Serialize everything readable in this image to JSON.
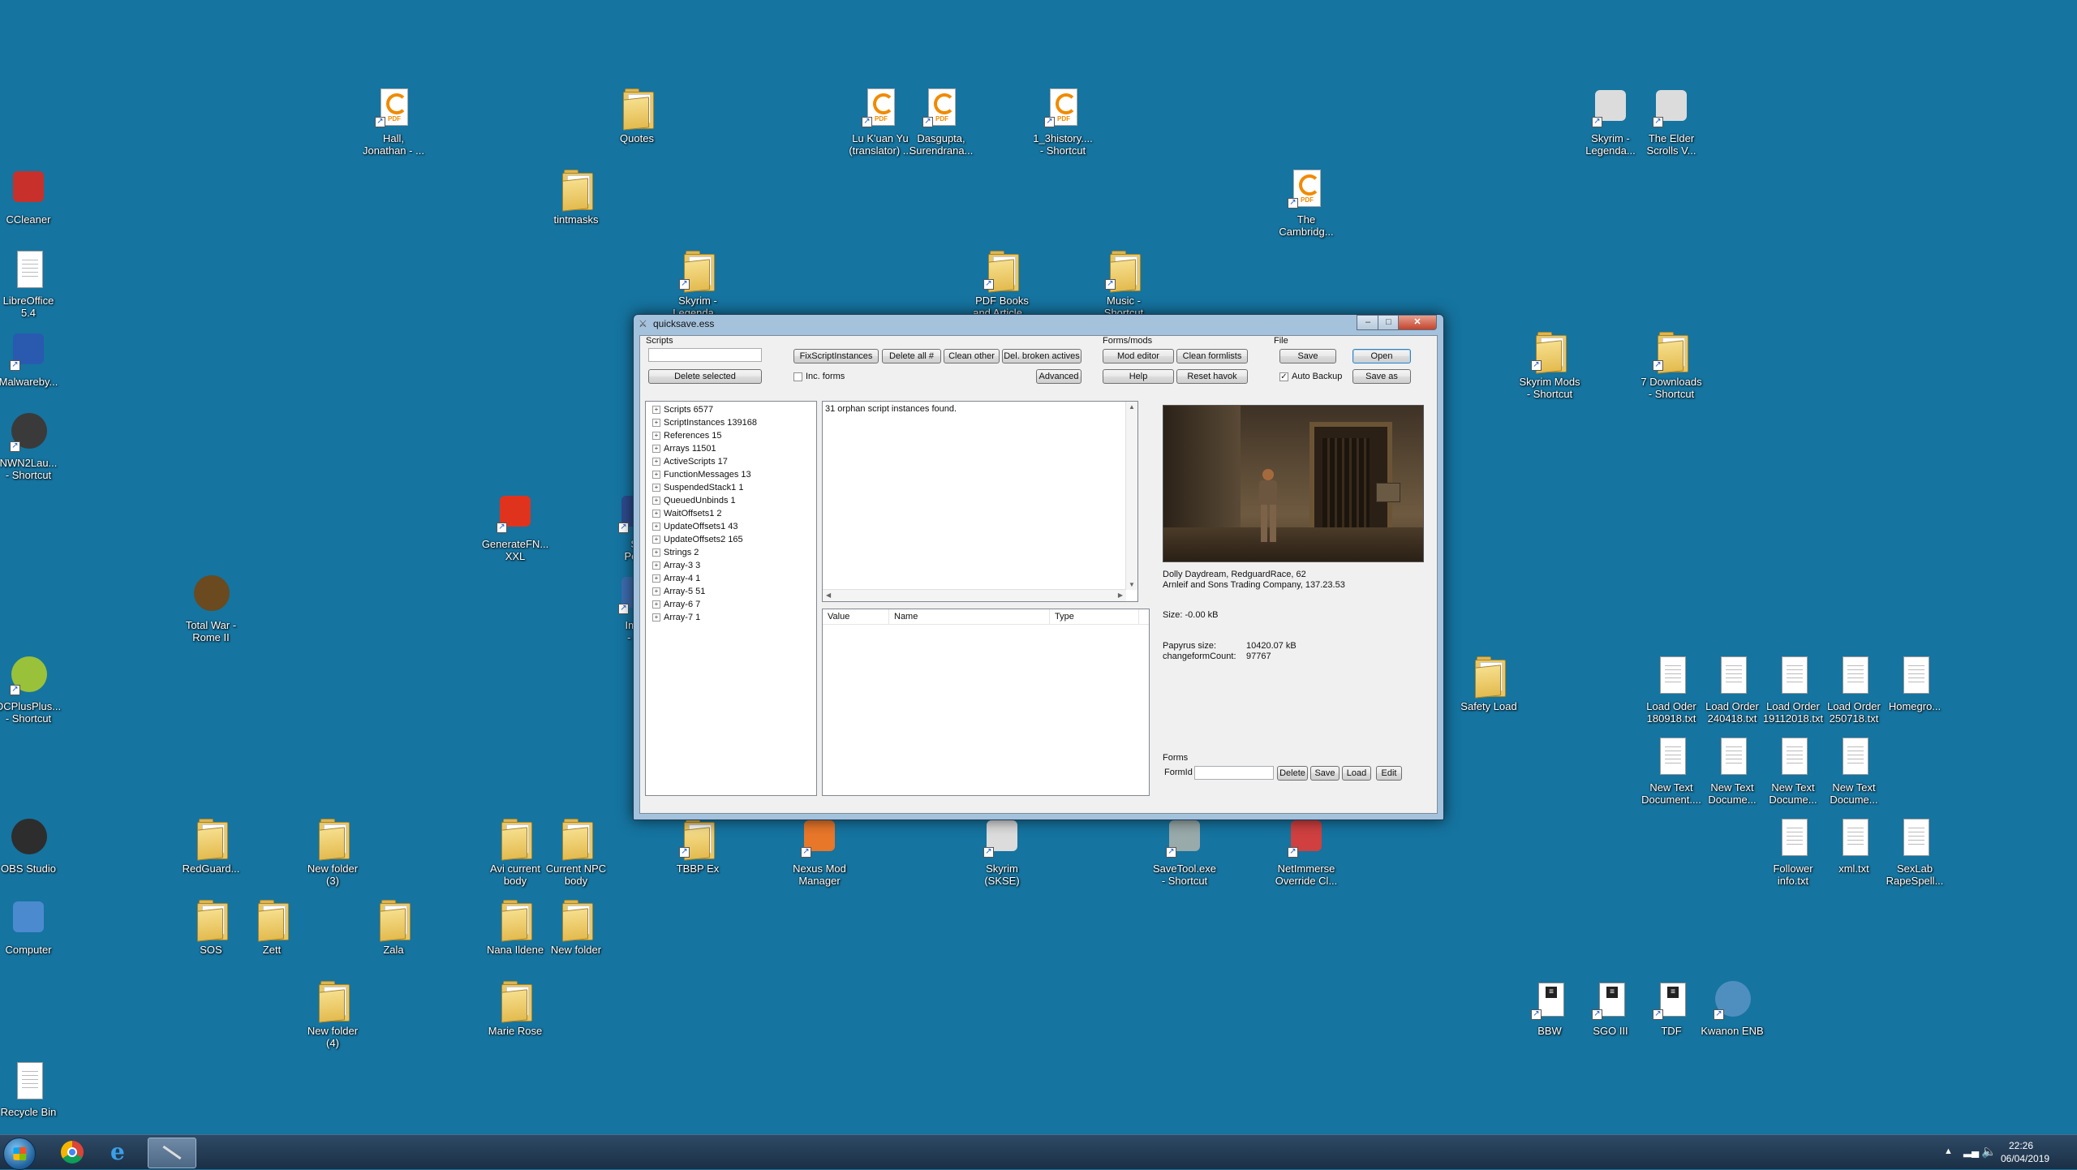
{
  "desktop": {
    "icons": [
      {
        "key": "ccleaner",
        "label": "CCleaner",
        "kind": "exe",
        "color": "#c8302b"
      },
      {
        "key": "libreoffice",
        "label": "LibreOffice\n5.4",
        "kind": "doc"
      },
      {
        "key": "malwarebytes",
        "label": "Malwareby...",
        "kind": "exe",
        "color": "#2a5ab0"
      },
      {
        "key": "nwn2",
        "label": "NWN2Lau...\n- Shortcut",
        "kind": "circ",
        "color": "#3a3a3a"
      },
      {
        "key": "total-war",
        "label": "Total War -\nRome II",
        "kind": "circ",
        "color": "#6a4a1e"
      },
      {
        "key": "dcplusplus",
        "label": "DCPlusPlus...\n- Shortcut",
        "kind": "circ",
        "color": "#9ac13a"
      },
      {
        "key": "obs",
        "label": "OBS Studio",
        "kind": "circ",
        "color": "#2d2d2d"
      },
      {
        "key": "computer",
        "label": "Computer",
        "kind": "exe",
        "color": "#4c8ad0"
      },
      {
        "key": "recycle",
        "label": "Recycle Bin",
        "kind": "doc"
      },
      {
        "key": "hall",
        "label": "Hall,\nJonathan - ...",
        "kind": "pdf"
      },
      {
        "key": "quotes",
        "label": "Quotes",
        "kind": "folder"
      },
      {
        "key": "tintmasks",
        "label": "tintmasks",
        "kind": "folder"
      },
      {
        "key": "lukuanyu",
        "label": "Lu K'uan Yu\n(translator) ...",
        "kind": "pdf"
      },
      {
        "key": "dasgupta",
        "label": "Dasgupta,\nSurendrana...",
        "kind": "pdf"
      },
      {
        "key": "history",
        "label": "1_3history....\n- Shortcut",
        "kind": "pdf"
      },
      {
        "key": "cambridge",
        "label": "The\nCambridg...",
        "kind": "pdf"
      },
      {
        "key": "skyrim-legenda-1",
        "label": "Skyrim -\nLegenda...",
        "kind": "folder"
      },
      {
        "key": "pdf-books",
        "label": "PDF Books\nand Article...",
        "kind": "folder"
      },
      {
        "key": "music",
        "label": "Music -\nShortcut",
        "kind": "folder"
      },
      {
        "key": "generatefnis",
        "label": "GenerateFN...\nXXL",
        "kind": "exe",
        "color": "#e0331e"
      },
      {
        "key": "skyrim-legenda-2",
        "label": "Skyrim -\nLegenda...",
        "kind": "exe",
        "color": "#dcdcdc"
      },
      {
        "key": "elder-scrolls",
        "label": "The Elder\nScrolls V...",
        "kind": "exe",
        "color": "#dcdcdc"
      },
      {
        "key": "skyrim-mods",
        "label": "Skyrim Mods\n- Shortcut",
        "kind": "folder"
      },
      {
        "key": "downloads",
        "label": "7 Downloads\n- Shortcut",
        "kind": "folder"
      },
      {
        "key": "safety-load",
        "label": "Safety Load",
        "kind": "folder"
      },
      {
        "key": "lo180918",
        "label": "Load Oder\n180918.txt",
        "kind": "doc"
      },
      {
        "key": "lo240418",
        "label": "Load Order\n240418.txt",
        "kind": "doc"
      },
      {
        "key": "lo19112018",
        "label": "Load Order\n19112018.txt",
        "kind": "doc"
      },
      {
        "key": "lo250718",
        "label": "Load Order\n250718.txt",
        "kind": "doc"
      },
      {
        "key": "homegro",
        "label": "Homegro...",
        "kind": "doc"
      },
      {
        "key": "ntd1",
        "label": "New Text\nDocument....",
        "kind": "doc"
      },
      {
        "key": "ntd2",
        "label": "New Text\nDocume...",
        "kind": "doc"
      },
      {
        "key": "ntd3",
        "label": "New Text\nDocume...",
        "kind": "doc"
      },
      {
        "key": "ntd4",
        "label": "New Text\nDocume...",
        "kind": "doc"
      },
      {
        "key": "follower",
        "label": "Follower\ninfo.txt",
        "kind": "doc"
      },
      {
        "key": "xml",
        "label": "xml.txt",
        "kind": "doc"
      },
      {
        "key": "sexlab",
        "label": "SexLab\nRapeSpell...",
        "kind": "doc"
      },
      {
        "key": "redguard",
        "label": "RedGuard...",
        "kind": "folder"
      },
      {
        "key": "nf3",
        "label": "New folder\n(3)",
        "kind": "folder"
      },
      {
        "key": "avi",
        "label": "Avi current\nbody",
        "kind": "folder"
      },
      {
        "key": "npc",
        "label": "Current NPC\nbody",
        "kind": "folder"
      },
      {
        "key": "tbbp",
        "label": "TBBP Ex",
        "kind": "folder"
      },
      {
        "key": "nmm",
        "label": "Nexus Mod\nManager",
        "kind": "exe",
        "color": "#e8772a"
      },
      {
        "key": "skse",
        "label": "Skyrim\n(SKSE)",
        "kind": "exe",
        "color": "#dcdcdc"
      },
      {
        "key": "savetool",
        "label": "SaveTool.exe\n- Shortcut",
        "kind": "exe",
        "color": "#9aa"
      },
      {
        "key": "netimmerse",
        "label": "NetImmerse\nOverride Cl...",
        "kind": "exe",
        "color": "#d04040"
      },
      {
        "key": "sos",
        "label": "SOS",
        "kind": "folder"
      },
      {
        "key": "zett",
        "label": "Zett",
        "kind": "folder"
      },
      {
        "key": "zala",
        "label": "Zala",
        "kind": "folder"
      },
      {
        "key": "nana",
        "label": "Nana Ildene",
        "kind": "folder"
      },
      {
        "key": "newfolder",
        "label": "New folder",
        "kind": "folder"
      },
      {
        "key": "nf4",
        "label": "New folder\n(4)",
        "kind": "folder"
      },
      {
        "key": "marie",
        "label": "Marie Rose",
        "kind": "folder"
      },
      {
        "key": "bbw",
        "label": "BBW",
        "kind": "ini"
      },
      {
        "key": "sgo",
        "label": "SGO III",
        "kind": "ini"
      },
      {
        "key": "tdf",
        "label": "TDF",
        "kind": "ini"
      },
      {
        "key": "kwanon",
        "label": "Kwanon ENB",
        "kind": "circ",
        "color": "#4f8fbf"
      },
      {
        "key": "partial-sk",
        "label": "Sk\nPerfo",
        "kind": "exe",
        "color": "#2c4b8c"
      },
      {
        "key": "partial-img",
        "label": "Imag\n- Sh",
        "kind": "exe",
        "color": "#3c6db0"
      }
    ]
  },
  "window": {
    "title": "quicksave.ess",
    "scripts_group_label": "Scripts",
    "delete_selected": "Delete selected",
    "fix_script_instances": "FixScriptInstances",
    "delete_all": "Delete all #",
    "clean_other": "Clean other",
    "del_broken_actives": "Del. broken actives",
    "inc_forms": "Inc. forms",
    "advanced": "Advanced",
    "forms_mods_label": "Forms/mods",
    "mod_editor": "Mod editor",
    "clean_formlists": "Clean formlists",
    "help": "Help",
    "reset_havok": "Reset havok",
    "file_label": "File",
    "save": "Save",
    "open": "Open",
    "auto_backup": "Auto Backup",
    "save_as": "Save as",
    "tree": [
      "Scripts 6577",
      "ScriptInstances 139168",
      "References 15",
      "Arrays 11501",
      "ActiveScripts 17",
      "FunctionMessages 13",
      "SuspendedStack1 1",
      "QueuedUnbinds 1",
      "WaitOffsets1 2",
      "UpdateOffsets1 43",
      "UpdateOffsets2 165",
      "Strings 2",
      "Array-3 3",
      "Array-4 1",
      "Array-5 51",
      "Array-6 7",
      "Array-7 1"
    ],
    "log_text": "31 orphan script instances found.",
    "columns": [
      "Value",
      "Name",
      "Type"
    ],
    "save_info": {
      "line1": "Dolly Daydream, RedguardRace, 62",
      "line2": "Arnleif and Sons Trading Company, 137.23.53",
      "size": "Size: -0.00 kB",
      "papyrus_label": "Papyrus size:",
      "papyrus_value": "10420.07 kB",
      "cfc_label": "changeformCount:",
      "cfc_value": "97767"
    },
    "forms_label": "Forms",
    "formid_label": "FormId",
    "form_delete": "Delete",
    "form_save": "Save",
    "form_load": "Load",
    "form_edit": "Edit",
    "title_buttons": {
      "minimize": "–",
      "maximize": "□",
      "close": "✕"
    }
  },
  "taskbar": {
    "time": "22:26",
    "date": "06/04/2019",
    "pinned": [
      {
        "key": "chrome",
        "icon": "chrome-icon"
      },
      {
        "key": "ie",
        "icon": "internet-explorer-icon"
      },
      {
        "key": "savetool",
        "icon": "savetool-icon"
      }
    ]
  }
}
